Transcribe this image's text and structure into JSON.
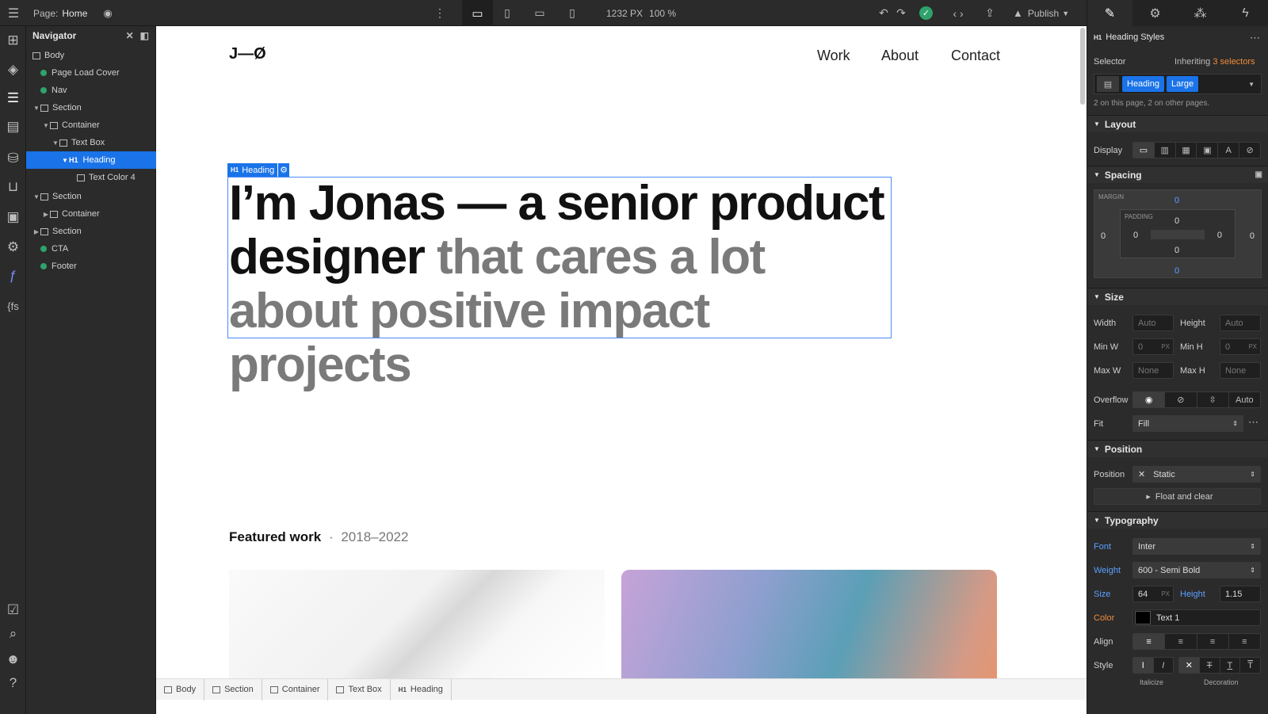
{
  "topbar": {
    "page_label": "Page:",
    "page_name": "Home",
    "width": "1232 PX",
    "zoom": "100 %",
    "publish": "Publish"
  },
  "navigator": {
    "title": "Navigator",
    "items": [
      {
        "label": "Body"
      },
      {
        "label": "Page Load Cover"
      },
      {
        "label": "Nav"
      },
      {
        "label": "Section"
      },
      {
        "label": "Container"
      },
      {
        "label": "Text Box"
      },
      {
        "label": "Heading"
      },
      {
        "label": "Text Color 4"
      },
      {
        "label": "Section"
      },
      {
        "label": "Container"
      },
      {
        "label": "Section"
      },
      {
        "label": "CTA"
      },
      {
        "label": "Footer"
      }
    ]
  },
  "site": {
    "logo": "J—Ø",
    "nav": [
      "Work",
      "About",
      "Contact"
    ],
    "heading_tag": "Heading",
    "hero_dark": "I’m Jonas — a senior product designer",
    "hero_muted": "that cares a lot about positive impact projects",
    "featured": "Featured work",
    "featured_years": "2018–2022"
  },
  "breadcrumbs": [
    "Body",
    "Section",
    "Container",
    "Text Box",
    "Heading"
  ],
  "style_panel": {
    "title": "Heading Styles",
    "selector_label": "Selector",
    "inheriting": "Inheriting",
    "selectors_count": "3 selectors",
    "class_1": "Heading",
    "class_2": "Large",
    "usage": "2 on this page, 2 on other pages.",
    "layout": "Layout",
    "display": "Display",
    "spacing": "Spacing",
    "margin_label": "MARGIN",
    "padding_label": "PADDING",
    "margin_top": "0",
    "margin_right": "0",
    "margin_bottom": "0",
    "margin_left": "0",
    "padding_top": "0",
    "padding_right": "0",
    "padding_bottom": "0",
    "padding_left": "0",
    "size": "Size",
    "width_label": "Width",
    "width_val": "Auto",
    "height_label": "Height",
    "height_val": "Auto",
    "minw_label": "Min W",
    "minw_val": "0",
    "minh_label": "Min H",
    "minh_val": "0",
    "maxw_label": "Max W",
    "maxw_val": "None",
    "maxh_label": "Max H",
    "maxh_val": "None",
    "px": "PX",
    "overflow_label": "Overflow",
    "overflow_auto": "Auto",
    "fit_label": "Fit",
    "fit_val": "Fill",
    "position": "Position",
    "position_label": "Position",
    "position_val": "Static",
    "float_clear": "Float and clear",
    "typography": "Typography",
    "font_label": "Font",
    "font_val": "Inter",
    "weight_label": "Weight",
    "weight_val": "600 - Semi Bold",
    "size_label": "Size",
    "size_val": "64",
    "height2_label": "Height",
    "height2_val": "1.15",
    "color_label": "Color",
    "color_val": "Text 1",
    "align_label": "Align",
    "style_label": "Style",
    "italicize": "Italicize",
    "decoration": "Decoration"
  }
}
